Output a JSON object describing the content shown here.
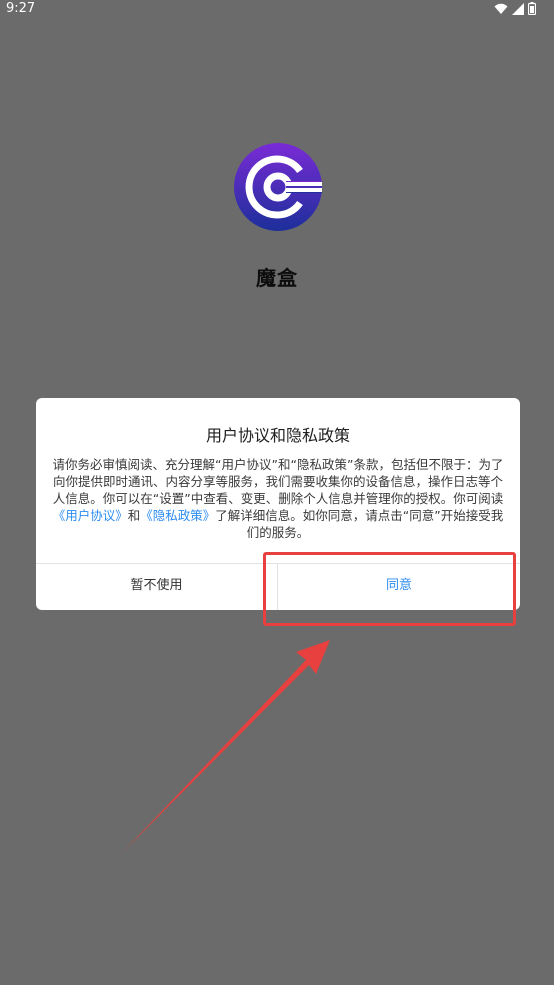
{
  "status_bar": {
    "time": "9:27",
    "icons": [
      "wifi-icon",
      "signal-icon",
      "battery-icon"
    ]
  },
  "app": {
    "name": "魔盒",
    "logo_icon": "app-logo-icon",
    "colors": {
      "logo_gradient_start": "#7a2bd6",
      "logo_gradient_end": "#1c2f9a",
      "background": "#6b6b6b"
    }
  },
  "dialog": {
    "title": "用户协议和隐私政策",
    "body_before_links": "请你务必审慎阅读、充分理解“用户协议”和“隐私政策”条款，包括但不限于：为了向你提供即时通讯、内容分享等服务，我们需要收集你的设备信息，操作日志等个人信息。你可以在“设置”中查看、变更、删除个人信息并管理你的授权。你可阅读",
    "link_user_agreement": "《用户协议》",
    "and_text": "和",
    "link_privacy_policy": "《隐私政策》",
    "body_after_links": "了解详细信息。如你同意，请点击“同意”开始接受我们的服务。",
    "decline_label": "暂不使用",
    "agree_label": "同意",
    "link_color": "#2d8cf0"
  },
  "annotation": {
    "highlight_color": "#e8403e"
  }
}
